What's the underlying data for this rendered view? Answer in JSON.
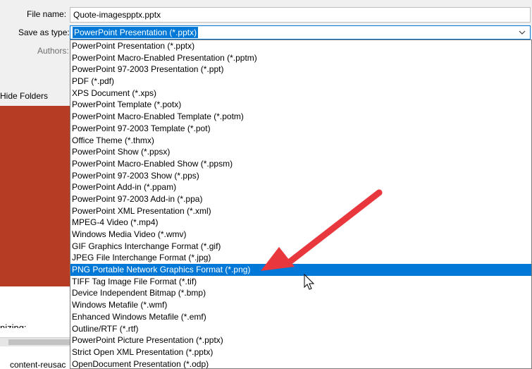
{
  "form": {
    "file_name_label": "File name:",
    "file_name_value": "Quote-imagespptx.pptx",
    "save_type_label": "Save as type:",
    "save_type_value": "PowerPoint Presentation (*.pptx)",
    "authors_label": "Authors:"
  },
  "sidebar": {
    "hide_folders_label": "Hide Folders",
    "partial_text": "nizing:",
    "bottom_file": "content-reusac"
  },
  "dropdown": {
    "highlighted_index": 19,
    "options": [
      "PowerPoint Presentation (*.pptx)",
      "PowerPoint Macro-Enabled Presentation (*.pptm)",
      "PowerPoint 97-2003 Presentation (*.ppt)",
      "PDF (*.pdf)",
      "XPS Document (*.xps)",
      "PowerPoint Template (*.potx)",
      "PowerPoint Macro-Enabled Template (*.potm)",
      "PowerPoint 97-2003 Template (*.pot)",
      "Office Theme (*.thmx)",
      "PowerPoint Show (*.ppsx)",
      "PowerPoint Macro-Enabled Show (*.ppsm)",
      "PowerPoint 97-2003 Show (*.pps)",
      "PowerPoint Add-in (*.ppam)",
      "PowerPoint 97-2003 Add-in (*.ppa)",
      "PowerPoint XML Presentation (*.xml)",
      "MPEG-4 Video (*.mp4)",
      "Windows Media Video (*.wmv)",
      "GIF Graphics Interchange Format (*.gif)",
      "JPEG File Interchange Format (*.jpg)",
      "PNG Portable Network Graphics Format (*.png)",
      "TIFF Tag Image File Format (*.tif)",
      "Device Independent Bitmap (*.bmp)",
      "Windows Metafile (*.wmf)",
      "Enhanced Windows Metafile (*.emf)",
      "Outline/RTF (*.rtf)",
      "PowerPoint Picture Presentation (*.pptx)",
      "Strict Open XML Presentation (*.pptx)",
      "OpenDocument Presentation (*.odp)"
    ]
  },
  "colors": {
    "highlight": "#0078d7",
    "arrow": "#e8383d",
    "thumbnail": "#b73c24"
  },
  "icons": {
    "dropdown_chevron": "chevron-down-icon",
    "annotation_arrow": "red-arrow-icon",
    "cursor": "mouse-pointer-icon"
  }
}
